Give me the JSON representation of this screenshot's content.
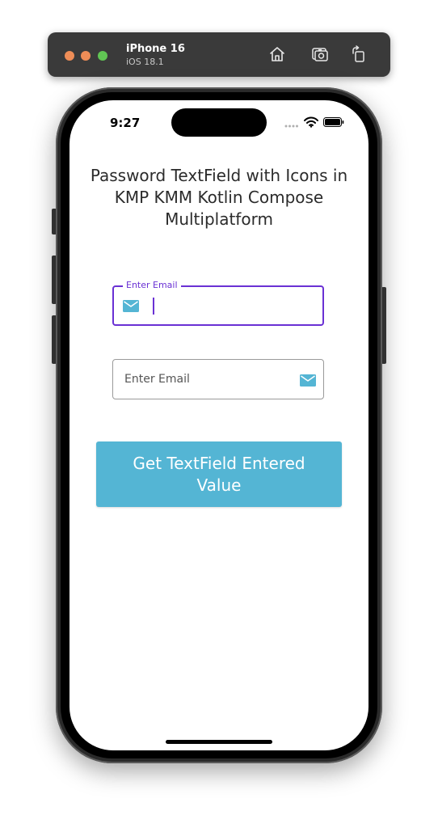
{
  "simulator": {
    "device_name": "iPhone 16",
    "os_version": "iOS 18.1",
    "icons": [
      "home-icon",
      "screenshot-icon",
      "rotate-icon"
    ]
  },
  "status_bar": {
    "time": "9:27"
  },
  "app": {
    "title": "Password TextField with Icons in KMP KMM Kotlin Compose Multiplatform",
    "email_field_focused": {
      "label": "Enter Email",
      "value": "",
      "icon": "mail-icon"
    },
    "email_field_trailing": {
      "placeholder": "Enter Email",
      "icon": "mail-icon"
    },
    "submit_button": {
      "label": "Get TextField Entered Value"
    }
  },
  "colors": {
    "accent_focus": "#6a31d4",
    "button": "#54b5d4",
    "icon": "#54b5d4",
    "simulator_bar": "#3a3a3a"
  }
}
